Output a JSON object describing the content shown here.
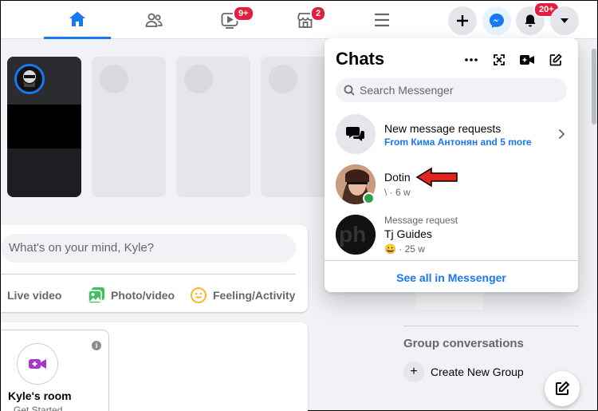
{
  "nav": {
    "watch_badge": "9+",
    "marketplace_badge": "2",
    "notif_badge": "20+"
  },
  "composer": {
    "placeholder": "What's on your mind, Kyle?",
    "actions": [
      "Live video",
      "Photo/video",
      "Feeling/Activity"
    ]
  },
  "room": {
    "title": "Kyle's room",
    "subtitle": "Get Started"
  },
  "contacts": {
    "group_title": "Group conversations",
    "create_group": "Create New Group"
  },
  "chats": {
    "title": "Chats",
    "search_placeholder": "Search Messenger",
    "requests": {
      "name": "New message requests",
      "sub": "From Кима Антонян and 5 more"
    },
    "conversations": [
      {
        "name": "Dotin",
        "snippet": "\\ · 6 w",
        "online": true
      },
      {
        "label": "Message request",
        "name": "Tj Guides",
        "snippet": "😀 · 25 w"
      }
    ],
    "see_all": "See all in Messenger"
  },
  "colors": {
    "accent": "#1877f2",
    "badge": "#e41e3f",
    "online": "#31a24c",
    "arrow": "#e0261b"
  },
  "icons": [
    "home-icon",
    "friends-icon",
    "watch-icon",
    "marketplace-icon",
    "menu-icon",
    "plus-icon",
    "messenger-icon",
    "bell-icon",
    "caret-icon",
    "more-icon",
    "expand-icon",
    "video-call-icon",
    "compose-icon",
    "search-icon",
    "chevron-right-icon"
  ]
}
